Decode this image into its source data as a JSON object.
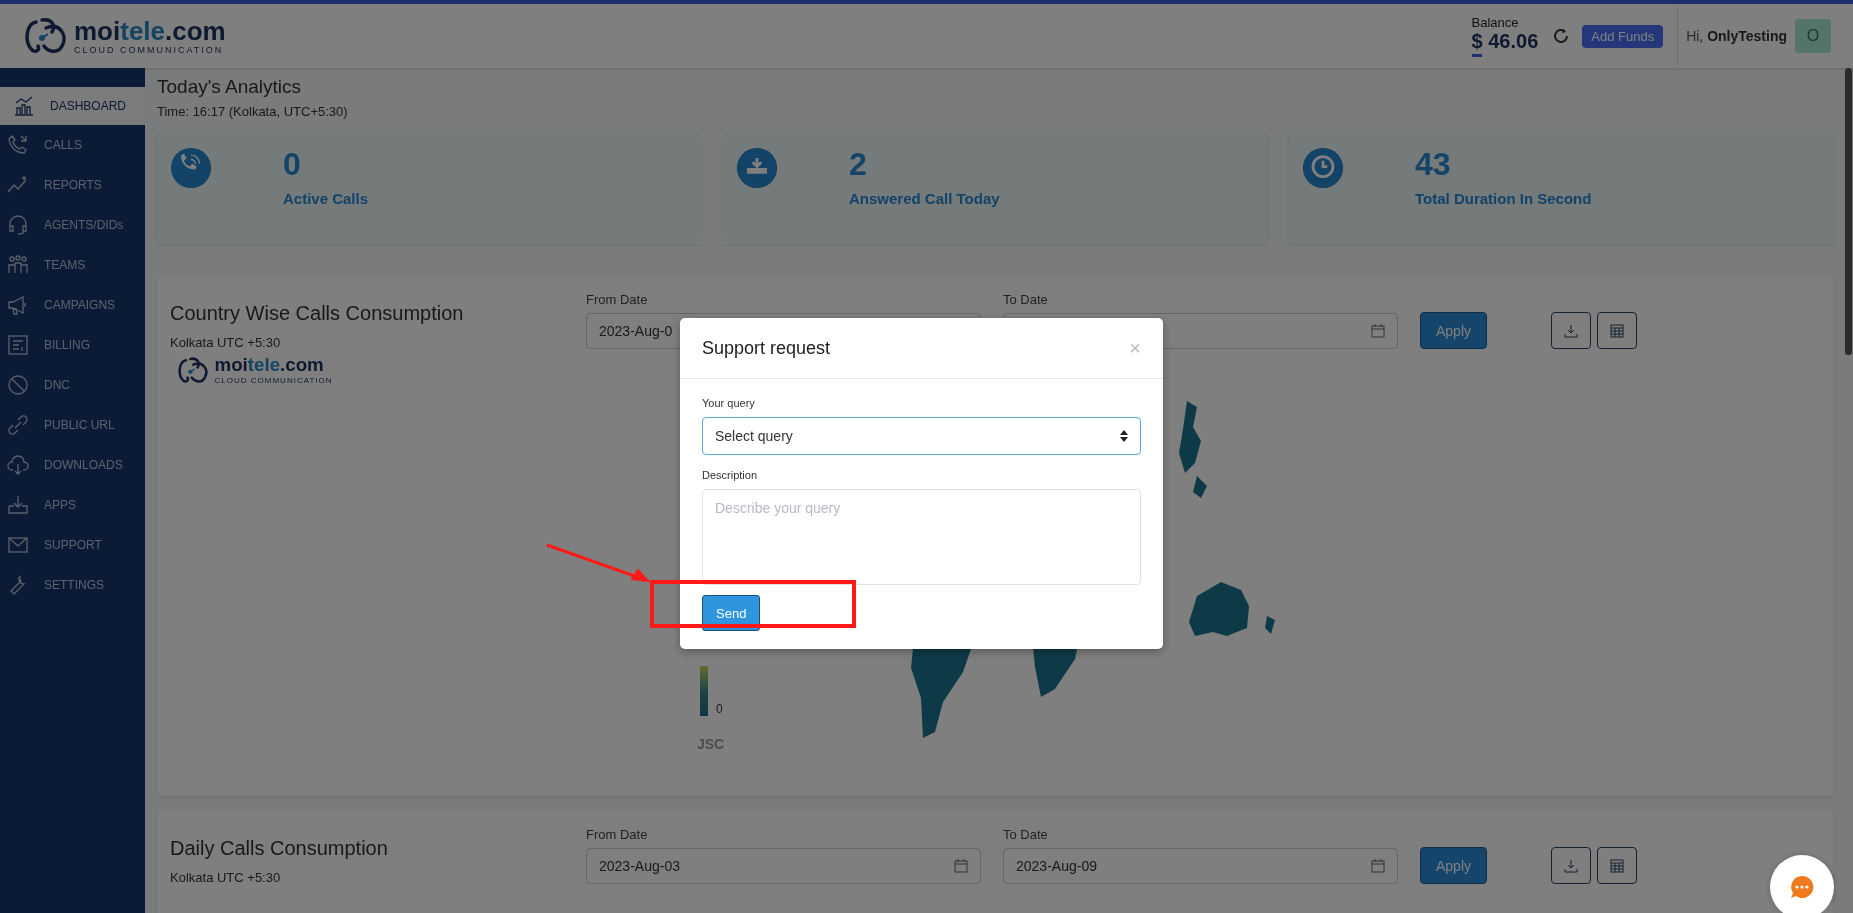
{
  "header": {
    "logo": {
      "name": [
        "moi",
        "tele",
        ".com"
      ],
      "tagline": "CLOUD COMMUNICATION"
    },
    "balance_label": "Balance",
    "balance": "$ 46.06",
    "add_funds": "Add Funds",
    "greeting": "Hi, **OnlyTesting**",
    "avatar": "O"
  },
  "sidebar": {
    "items": [
      {
        "label": "DASHBOARD",
        "selected": true
      },
      {
        "label": "CALLS",
        "selected": false
      },
      {
        "label": "REPORTS",
        "selected": false
      },
      {
        "label": "AGENTS/DIDs",
        "selected": false
      },
      {
        "label": "TEAMS",
        "selected": false
      },
      {
        "label": "CAMPAIGNS",
        "selected": false
      },
      {
        "label": "BILLING",
        "selected": false
      },
      {
        "label": "DNC",
        "selected": false
      },
      {
        "label": "PUBLIC URL",
        "selected": false
      },
      {
        "label": "DOWNLOADS",
        "selected": false
      },
      {
        "label": "APPS",
        "selected": false
      },
      {
        "label": "SUPPORT",
        "selected": false
      },
      {
        "label": "SETTINGS",
        "selected": false
      }
    ]
  },
  "analytics": {
    "title": "Today's Analytics",
    "time": "Time: 16:17 (Kolkata, UTC+5:30)",
    "stats": [
      {
        "value": "0",
        "label": "Active Calls"
      },
      {
        "value": "2",
        "label": "Answered Call Today"
      },
      {
        "value": "43",
        "label": "Total Duration In Second"
      }
    ]
  },
  "sections": [
    {
      "kind": "map",
      "title": "Country Wise Calls Consumption",
      "timezone": "Kolkata UTC +5:30",
      "from_label": "From Date",
      "from_value": "2023-Aug-0",
      "to_label": "To Date",
      "apply": "Apply",
      "logo": {
        "name": [
          "moi",
          "tele",
          ".com"
        ],
        "tagline": "CLOUD COMMUNICATION"
      },
      "legend_min": "0",
      "credit": "JSC"
    },
    {
      "kind": "plain",
      "title": "Daily Calls Consumption",
      "timezone": "Kolkata UTC +5:30",
      "from_label": "From Date",
      "from_value": "2023-Aug-03",
      "to_label": "To Date",
      "to_value": "2023-Aug-09",
      "apply": "Apply"
    }
  ],
  "modal": {
    "title": "Support request",
    "close": "×",
    "query_label": "Your query",
    "query_value": "Select query",
    "description_label": "Description",
    "description_placeholder": "Describe your query",
    "send": "Send"
  }
}
